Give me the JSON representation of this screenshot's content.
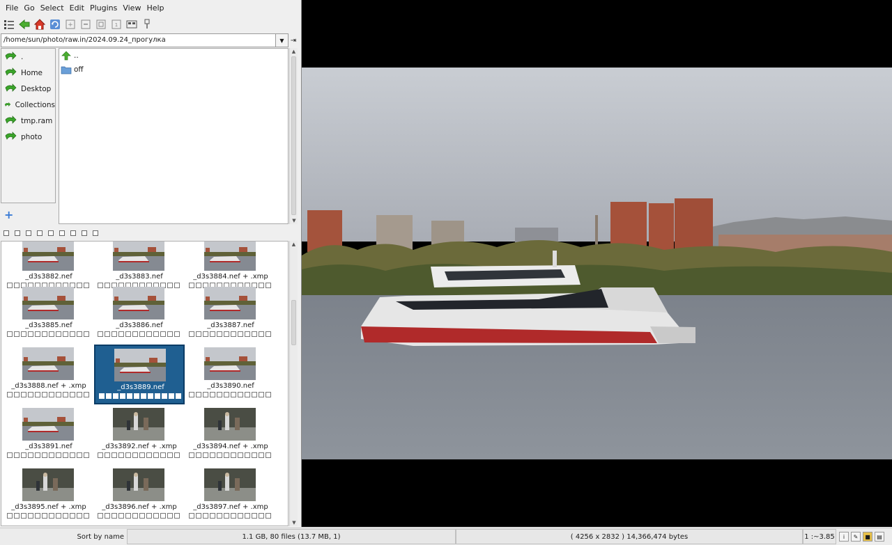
{
  "menu": [
    "File",
    "Go",
    "Select",
    "Edit",
    "Plugins",
    "View",
    "Help"
  ],
  "path": {
    "value": "/home/sun/photo/raw.in/2024.09.24_прогулка"
  },
  "bookmarks": [
    ".",
    "Home",
    "Desktop",
    "Collections",
    "tmp.ram",
    "photo"
  ],
  "files": [
    {
      "name": "..",
      "icon": "up-arrow-icon"
    },
    {
      "name": "off",
      "icon": "folder-icon"
    }
  ],
  "thumbnails": [
    {
      "caption": "_d3s3882.nef",
      "kind": "boat",
      "selected": false
    },
    {
      "caption": "_d3s3883.nef",
      "kind": "boat",
      "selected": false
    },
    {
      "caption": "_d3s3884.nef + .xmp",
      "kind": "boat",
      "selected": false
    },
    {
      "caption": "_d3s3885.nef",
      "kind": "boat",
      "selected": false
    },
    {
      "caption": "_d3s3886.nef",
      "kind": "boat",
      "selected": false
    },
    {
      "caption": "_d3s3887.nef",
      "kind": "boat",
      "selected": false
    },
    {
      "caption": "_d3s3888.nef + .xmp",
      "kind": "boat",
      "selected": false
    },
    {
      "caption": "_d3s3889.nef",
      "kind": "boat",
      "selected": true
    },
    {
      "caption": "_d3s3890.nef",
      "kind": "boat",
      "selected": false
    },
    {
      "caption": "_d3s3891.nef",
      "kind": "boat",
      "selected": false
    },
    {
      "caption": "_d3s3892.nef + .xmp",
      "kind": "people",
      "selected": false
    },
    {
      "caption": "_d3s3894.nef + .xmp",
      "kind": "people",
      "selected": false
    },
    {
      "caption": "_d3s3895.nef + .xmp",
      "kind": "people",
      "selected": false
    },
    {
      "caption": "_d3s3896.nef + .xmp",
      "kind": "people",
      "selected": false
    },
    {
      "caption": "_d3s3897.nef + .xmp",
      "kind": "people",
      "selected": false
    }
  ],
  "status": {
    "sort": "Sort by name",
    "summary": "1.1 GB, 80 files (13.7 MB, 1)",
    "image_info": "( 4256 x 2832 ) 14,366,474 bytes",
    "zoom": "1 :~3.85"
  },
  "colors": {
    "selection": "#1f5f91",
    "bookmark_arrow": "#3aa52a"
  }
}
